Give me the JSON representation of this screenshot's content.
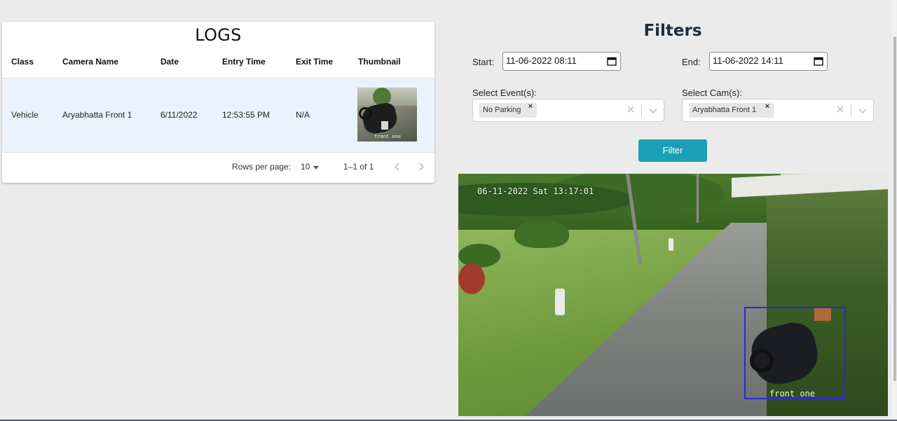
{
  "logs": {
    "title": "LOGS",
    "columns": [
      "Class",
      "Camera Name",
      "Date",
      "Entry Time",
      "Exit Time",
      "Thumbnail"
    ],
    "rows": [
      {
        "class": "Vehicle",
        "camera_name": "Aryabhatta Front 1",
        "date": "6/11/2022",
        "entry_time": "12:53:55 PM",
        "exit_time": "N/A",
        "thumbnail_caption": "front one"
      }
    ],
    "pagination": {
      "rows_per_page_label": "Rows per page:",
      "rows_per_page_value": "10",
      "range": "1–1 of 1"
    }
  },
  "filters": {
    "title": "Filters",
    "start_label": "Start:",
    "start_value": "11-06-2022 08:11",
    "end_label": "End:",
    "end_value": "11-06-2022 14:11",
    "events_label": "Select Event(s):",
    "events_selected": [
      "No Parking"
    ],
    "cams_label": "Select Cam(s):",
    "cams_selected": [
      "Aryabhatta Front 1"
    ],
    "filter_button": "Filter"
  },
  "feed": {
    "timestamp": "06-11-2022 Sat 13:17:01",
    "camera_label": "front one"
  },
  "icons": {
    "calendar": "calendar-icon",
    "remove": "close-icon",
    "clear": "clear-icon",
    "dropdown": "chevron-down-icon",
    "prev": "chevron-left-icon",
    "next": "chevron-right-icon"
  },
  "colors": {
    "accent": "#1aa0b5",
    "selected_row": "#eaf2fd",
    "detection_box": "#2a2ad8"
  }
}
